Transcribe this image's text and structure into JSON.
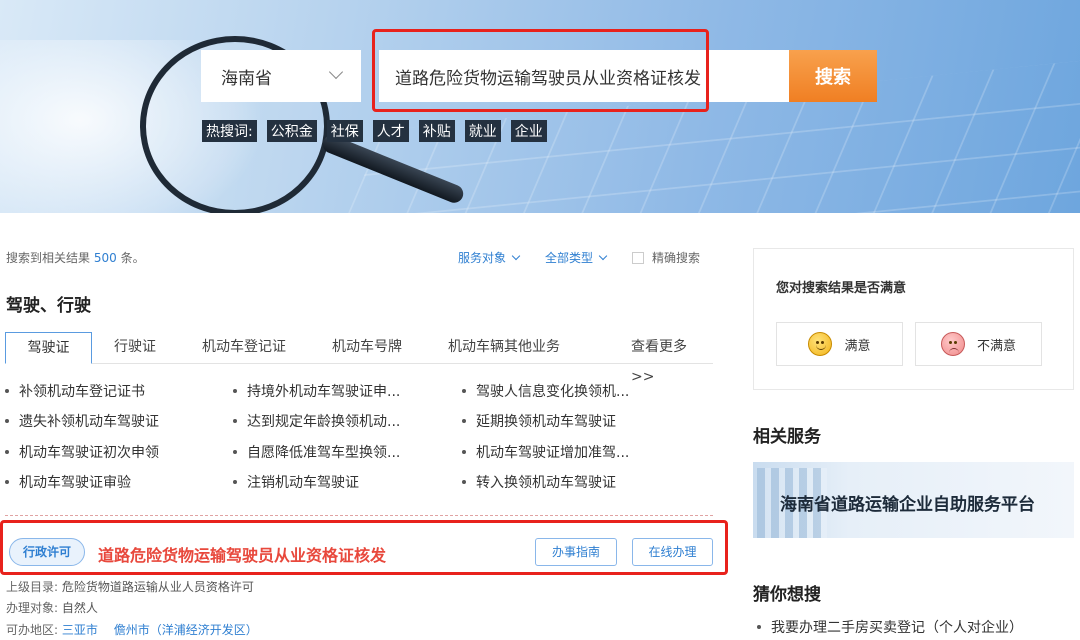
{
  "search": {
    "province": "海南省",
    "query": "道路危险货物运输驾驶员从业资格证核发",
    "button_label": "搜索",
    "hot_label": "热搜词:",
    "hot_terms": [
      "公积金",
      "社保",
      "人才",
      "补贴",
      "就业",
      "企业"
    ]
  },
  "results": {
    "count_prefix": "搜索到相关结果",
    "count": "500",
    "count_suffix": "条。",
    "filters": {
      "target": "服务对象",
      "type": "全部类型",
      "exact": "精确搜索"
    }
  },
  "category": {
    "title": "驾驶、行驶",
    "tabs": [
      "驾驶证",
      "行驶证",
      "机动车登记证",
      "机动车号牌",
      "机动车辆其他业务"
    ],
    "more": "查看更多 >>",
    "services": [
      "补领机动车登记证书",
      "持境外机动车驾驶证申...",
      "驾驶人信息变化换领机...",
      "遗失补领机动车驾驶证",
      "达到规定年龄换领机动...",
      "延期换领机动车驾驶证",
      "机动车驾驶证初次申领",
      "自愿降低准驾车型换领...",
      "机动车驾驶证增加准驾...",
      "机动车驾驶证审验",
      "注销机动车驾驶证",
      "转入换领机动车驾驶证"
    ]
  },
  "item": {
    "badge": "行政许可",
    "title": "道路危险货物运输驾驶员从业资格证核发",
    "guide_button": "办事指南",
    "online_button": "在线办理",
    "parent_label": "上级目录:",
    "parent_value": "危险货物道路运输从业人员资格许可",
    "target_label": "办理对象:",
    "target_value": "自然人",
    "region_label": "可办地区:",
    "regions": [
      "三亚市",
      "儋州市（洋浦经济开发区）"
    ]
  },
  "sidebar": {
    "satisfaction_title": "您对搜索结果是否满意",
    "satisfied": "满意",
    "unsatisfied": "不满意",
    "related_title": "相关服务",
    "promo_text": "海南省道路运输企业自助服务平台",
    "guess_title": "猜你想搜",
    "guess_items": [
      "我要办理二手房买卖登记（个人对企业）"
    ]
  },
  "colors": {
    "accent_blue": "#2f7fd1",
    "search_orange": "#f07f23",
    "highlight_red": "#e8221c",
    "item_title_red": "#e8483c"
  }
}
